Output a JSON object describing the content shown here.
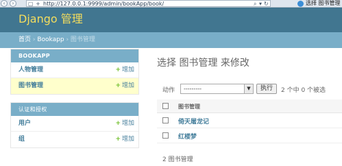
{
  "browser": {
    "address": "http://127.0.0.1:9999/admin/bookApp/book/",
    "tab_title": "选择 图书管理",
    "back_glyph": "‹",
    "forward_glyph": "›",
    "compat_glyph": "+",
    "search_glyph": "⌕",
    "search_dropdown_glyph": "▾",
    "refresh_glyph": "↻"
  },
  "header": {
    "brand": "Django 管理"
  },
  "breadcrumbs": {
    "home": "首页",
    "sep1": "›",
    "app": "Bookapp",
    "sep2": "›",
    "current": "图书管理"
  },
  "sidebar": {
    "modules": [
      {
        "caption": "BOOKAPP",
        "models": [
          {
            "name": "人物管理",
            "add_label": "增加",
            "add_glyph": "+"
          },
          {
            "name": "图书管理",
            "add_label": "增加",
            "add_glyph": "+"
          }
        ]
      },
      {
        "caption": "认证和授权",
        "models": [
          {
            "name": "用户",
            "add_label": "增加",
            "add_glyph": "+"
          },
          {
            "name": "组",
            "add_label": "增加",
            "add_glyph": "+"
          }
        ]
      }
    ]
  },
  "content": {
    "title": "选择 图书管理 来修改",
    "actions": {
      "label": "动作",
      "selected_option": "---------",
      "arrow_glyph": "▼",
      "go_label": "执行",
      "counter": "2 个中 0 个被选"
    },
    "table": {
      "header": "图书管理",
      "rows": [
        "倚天屠龙记",
        "红楼梦"
      ]
    },
    "paginator": "2 图书管理"
  },
  "colors": {
    "header_bg": "#417690",
    "brand_text": "#f5dd5d",
    "breadcrumb_bg": "#79aec8",
    "link": "#447e9b",
    "add_icon": "#70bf2b",
    "selected_row": "#ffffcc"
  }
}
